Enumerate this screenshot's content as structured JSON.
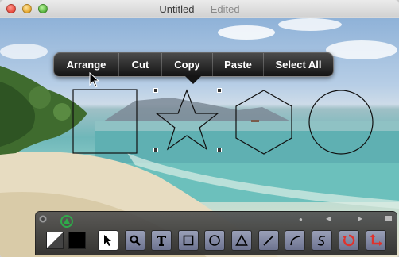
{
  "window": {
    "title": "Untitled",
    "edited_suffix": "— Edited"
  },
  "context_menu": {
    "items": [
      "Arrange",
      "Cut",
      "Copy",
      "Paste",
      "Select All"
    ]
  },
  "toolbar": {
    "tools": [
      {
        "name": "select-tool",
        "icon": "arrow-cursor-icon",
        "selected": true
      },
      {
        "name": "zoom-tool",
        "icon": "magnifier-icon",
        "selected": false
      },
      {
        "name": "text-tool",
        "icon": "text-t-icon",
        "selected": false
      },
      {
        "name": "rectangle-tool",
        "icon": "square-icon",
        "selected": false
      },
      {
        "name": "ellipse-tool",
        "icon": "circle-icon",
        "selected": false
      },
      {
        "name": "triangle-tool",
        "icon": "triangle-icon",
        "selected": false
      },
      {
        "name": "line-tool",
        "icon": "line-icon",
        "selected": false
      },
      {
        "name": "arc-tool",
        "icon": "arc-icon",
        "selected": false
      },
      {
        "name": "curve-tool",
        "icon": "s-curve-icon",
        "selected": false
      },
      {
        "name": "rotate-tool",
        "icon": "rotate-icon",
        "selected": false
      },
      {
        "name": "crop-tool",
        "icon": "crop-arrows-icon",
        "selected": false
      }
    ],
    "stroke_color": "#ffffff",
    "fill_color": "#000000",
    "accent_color": "#2faa4a"
  }
}
